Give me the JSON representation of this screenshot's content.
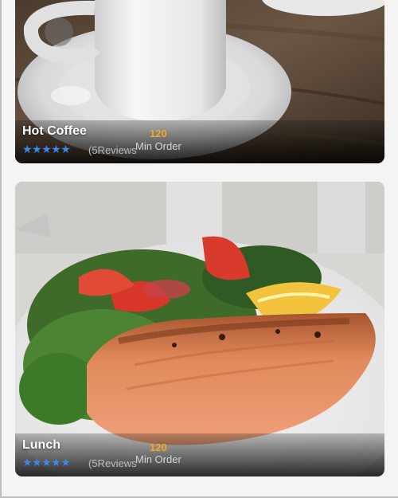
{
  "cards": [
    {
      "title": "Hot Coffee",
      "stars": "★★★★★",
      "rating": 5,
      "reviews": "(5Reviews",
      "price": "120",
      "min_order_label": "Min Order"
    },
    {
      "title": "Lunch",
      "stars": "★★★★★",
      "rating": 5,
      "reviews": "(5Reviews",
      "price": "120",
      "min_order_label": "Min Order"
    }
  ],
  "colors": {
    "star": "#3f86e8",
    "price": "#f5a623",
    "page_bg": "#f4f4f4"
  }
}
